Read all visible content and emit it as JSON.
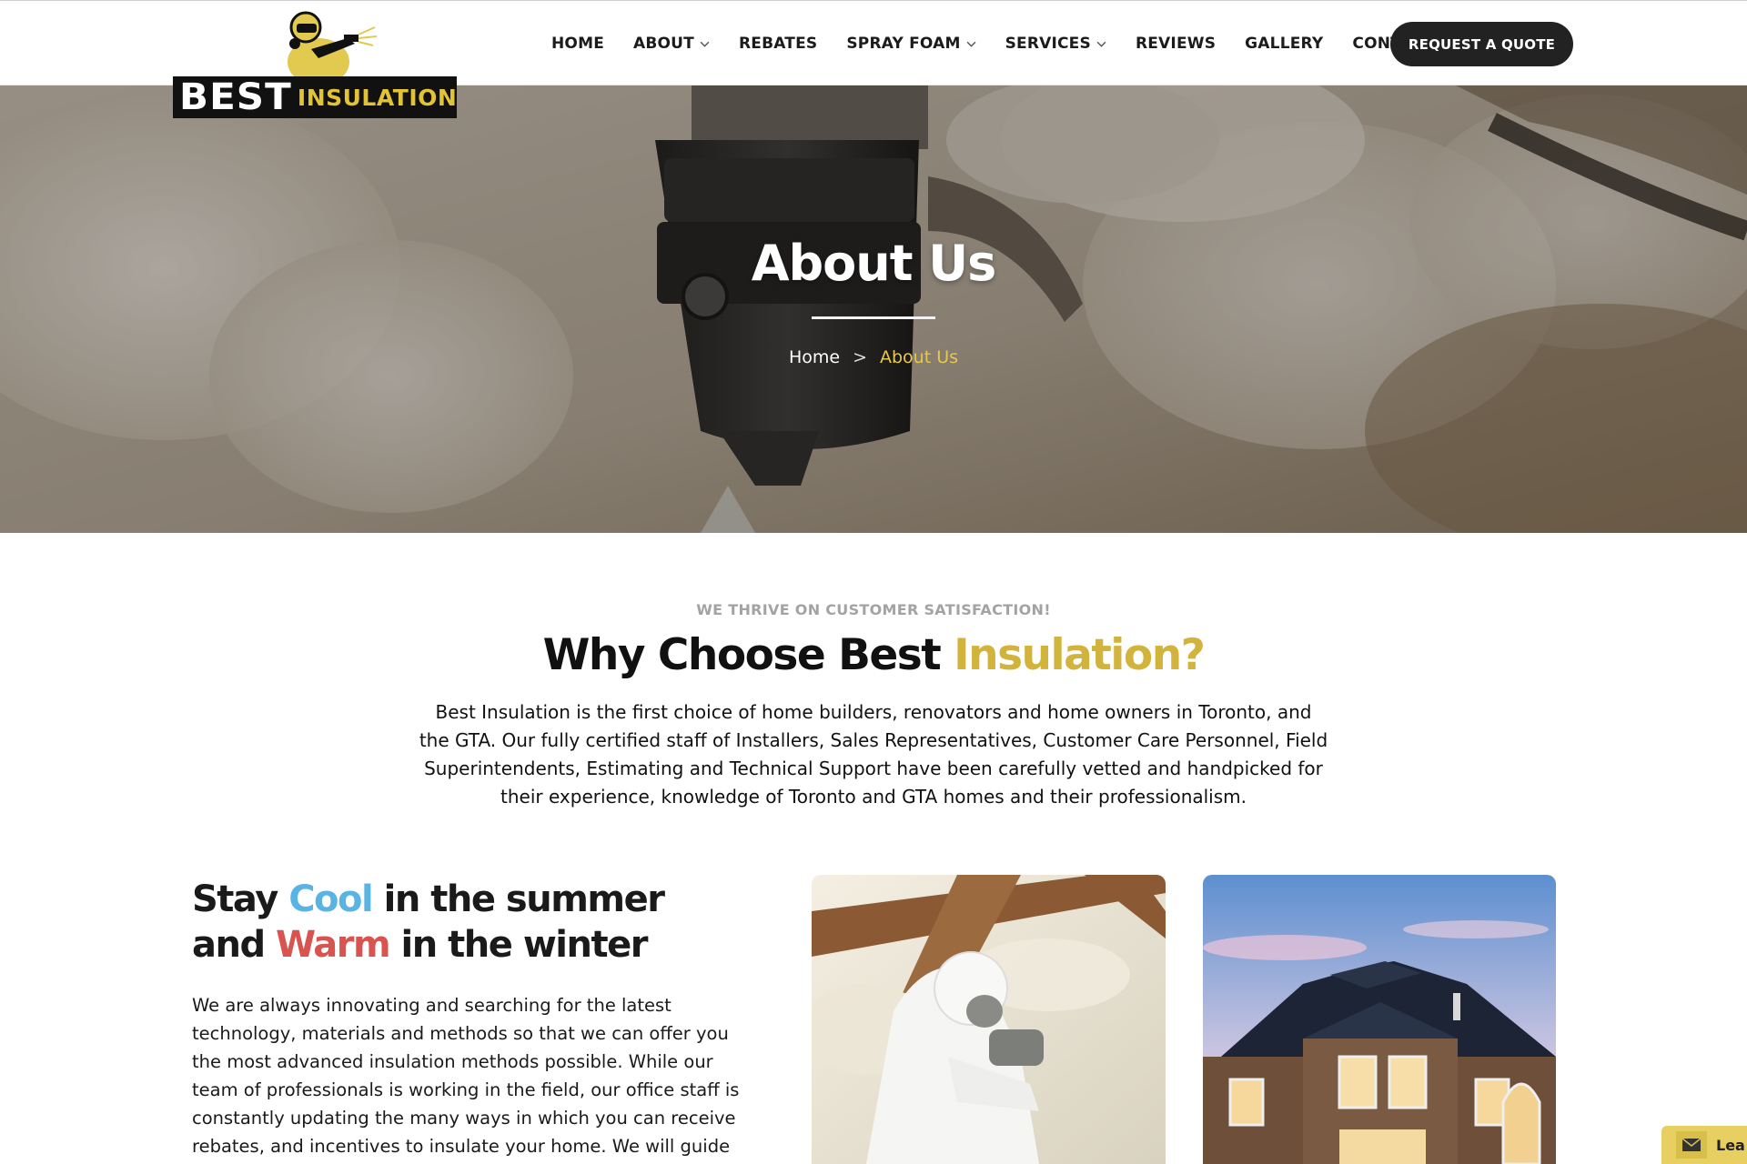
{
  "logo": {
    "word1": "BEST",
    "word2": "INSULATION"
  },
  "nav": {
    "items": [
      {
        "label": "HOME",
        "dropdown": false
      },
      {
        "label": "ABOUT",
        "dropdown": true
      },
      {
        "label": "REBATES",
        "dropdown": false
      },
      {
        "label": "SPRAY FOAM",
        "dropdown": true
      },
      {
        "label": "SERVICES",
        "dropdown": true
      },
      {
        "label": "REVIEWS",
        "dropdown": false
      },
      {
        "label": "GALLERY",
        "dropdown": false
      },
      {
        "label": "CONTACT",
        "dropdown": false
      }
    ],
    "cta": "REQUEST A QUOTE"
  },
  "hero": {
    "title": "About Us",
    "breadcrumb": {
      "home": "Home",
      "separator": ">",
      "current": "About Us"
    }
  },
  "why": {
    "eyebrow": "WE THRIVE ON CUSTOMER SATISFACTION!",
    "title_main": "Why Choose Best ",
    "title_accent": "Insulation?",
    "body": "Best Insulation is the first choice of home builders, renovators and home owners in Toronto, and the GTA. Our fully certified staff of Installers, Sales Representatives, Customer Care Personnel, Field Superintendents, Estimating and Technical Support have been carefully vetted and handpicked for their experience, knowledge of Toronto and GTA homes and their professionalism."
  },
  "cool": {
    "line1_a": "Stay ",
    "line1_cool": "Cool",
    "line1_b": " in the summer",
    "line2_a": "and ",
    "line2_warm": "Warm",
    "line2_b": " in the winter",
    "body": "We are always innovating and searching for the latest technology, materials and methods so that we can offer you the most advanced insulation methods possible. While our team of professionals is working in the field, our office staff is constantly updating the many ways in which you can receive rebates, and incentives to insulate your home. We will guide you every step of"
  },
  "lead_tab": {
    "label": "Lea",
    "icon": "mail-icon"
  },
  "colors": {
    "accent_gold": "#d2b33b",
    "breadcrumb_gold": "#e6c84a",
    "cool_blue": "#5ab4e3",
    "warm_red": "#d9534f",
    "cta_bg": "#222222"
  }
}
